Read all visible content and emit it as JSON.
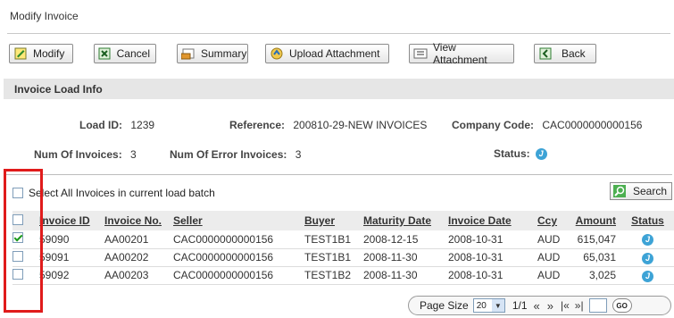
{
  "window": {
    "title": "Modify Invoice"
  },
  "toolbar": {
    "modify_label": "Modify",
    "cancel_label": "Cancel",
    "summary_label": "Summary",
    "upload_label": "Upload Attachment",
    "view_label": "View Attachment",
    "back_label": "Back"
  },
  "section": {
    "title": "Invoice Load Info"
  },
  "info": {
    "load_id_label": "Load ID:",
    "load_id": "1239",
    "reference_label": "Reference:",
    "reference": "200810-29-NEW INVOICES",
    "company_code_label": "Company Code:",
    "company_code": "CAC0000000000156",
    "num_invoices_label": "Num Of Invoices:",
    "num_invoices": "3",
    "num_error_label": "Num Of Error Invoices:",
    "num_error": "3",
    "status_label": "Status:"
  },
  "select_all": {
    "label": "Select All Invoices in current load batch",
    "checked": false
  },
  "search": {
    "label": "Search"
  },
  "table": {
    "columns": [
      "Invoice ID",
      "Invoice No.",
      "Seller",
      "Buyer",
      "Maturity Date",
      "Invoice Date",
      "Ccy",
      "Amount",
      "Status"
    ],
    "rows": [
      {
        "checked": true,
        "id": "59090",
        "no": "AA00201",
        "seller": "CAC0000000000156",
        "buyer": "TEST1B1",
        "maturity": "2008-12-15",
        "invdate": "2008-10-31",
        "ccy": "AUD",
        "amount": "615,047"
      },
      {
        "checked": false,
        "id": "59091",
        "no": "AA00202",
        "seller": "CAC0000000000156",
        "buyer": "TEST1B1",
        "maturity": "2008-11-30",
        "invdate": "2008-10-31",
        "ccy": "AUD",
        "amount": "65,031"
      },
      {
        "checked": false,
        "id": "59092",
        "no": "AA00203",
        "seller": "CAC0000000000156",
        "buyer": "TEST1B2",
        "maturity": "2008-11-30",
        "invdate": "2008-10-31",
        "ccy": "AUD",
        "amount": "3,025"
      }
    ]
  },
  "pager": {
    "page_size_label": "Page Size",
    "page_size": "20",
    "page_info": "1/1",
    "go_label": "GO"
  },
  "colors": {
    "highlight": "#e01b1b",
    "status_icon": "#3da3d6",
    "check": "#1c9a1c"
  }
}
